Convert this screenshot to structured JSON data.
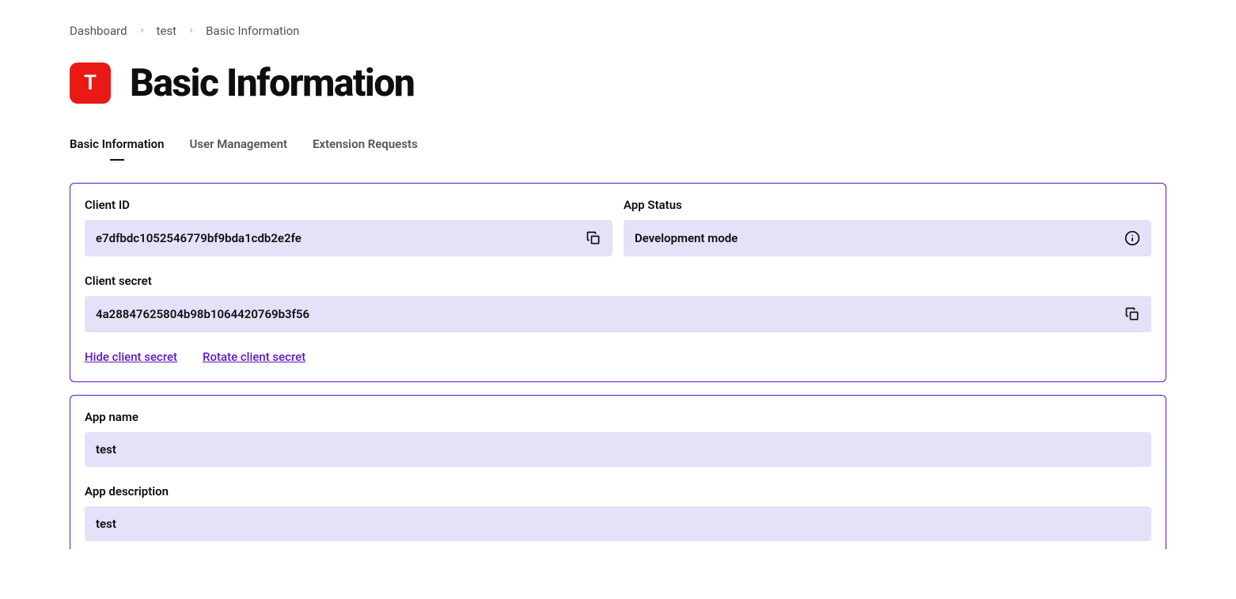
{
  "breadcrumb": {
    "items": [
      "Dashboard",
      "test",
      "Basic Information"
    ]
  },
  "header": {
    "icon_letter": "T",
    "title": "Basic Information"
  },
  "tabs": {
    "items": [
      {
        "label": "Basic Information",
        "active": true
      },
      {
        "label": "User Management",
        "active": false
      },
      {
        "label": "Extension Requests",
        "active": false
      }
    ]
  },
  "credentials": {
    "client_id_label": "Client ID",
    "client_id_value": "e7dfbdc1052546779bf9bda1cdb2e2fe",
    "app_status_label": "App Status",
    "app_status_value": "Development mode",
    "client_secret_label": "Client secret",
    "client_secret_value": "4a28847625804b98b1064420769b3f56",
    "hide_secret_link": "Hide client secret",
    "rotate_secret_link": "Rotate client secret"
  },
  "app_details": {
    "name_label": "App name",
    "name_value": "test",
    "description_label": "App description",
    "description_value": "test"
  }
}
